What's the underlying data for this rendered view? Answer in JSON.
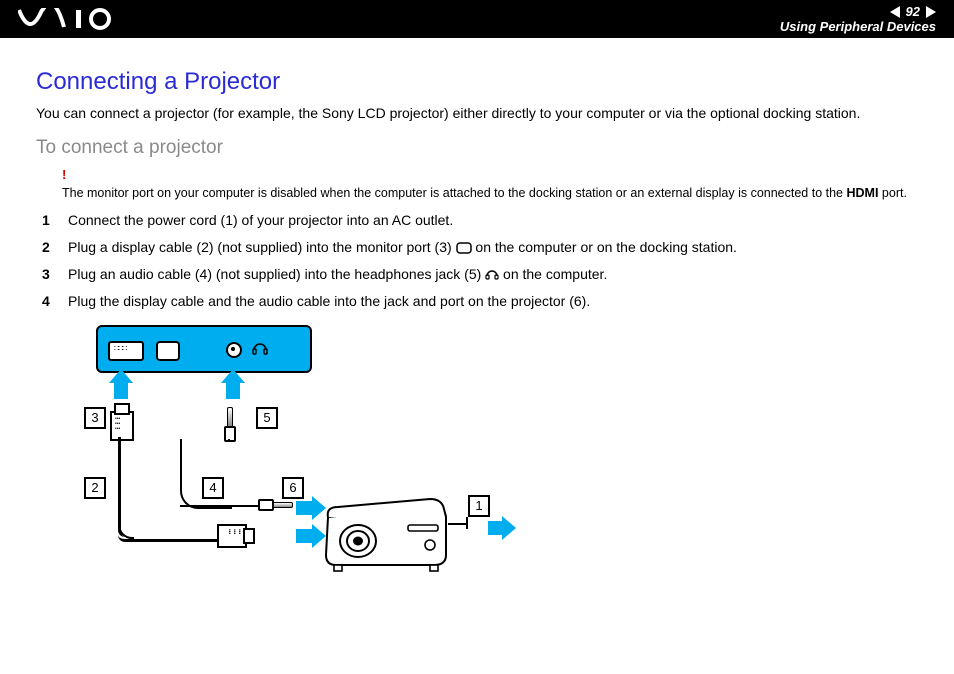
{
  "header": {
    "page_number": "92",
    "section": "Using Peripheral Devices"
  },
  "title": "Connecting a Projector",
  "intro": "You can connect a projector (for example, the Sony LCD projector) either directly to your computer or via the optional docking station.",
  "subtitle": "To connect a projector",
  "note": {
    "mark": "!",
    "text_before_bold": "The monitor port on your computer is disabled when the computer is attached to the docking station or an external display is connected to the ",
    "bold": "HDMI",
    "text_after_bold": " port."
  },
  "steps": [
    {
      "text": "Connect the power cord (1) of your projector into an AC outlet."
    },
    {
      "before": "Plug a display cable (2) (not supplied) into the monitor port (3) ",
      "icon": "monitor-port-icon",
      "after": " on the computer or on the docking station."
    },
    {
      "before": "Plug an audio cable (4) (not supplied) into the headphones jack (5) ",
      "icon": "headphones-icon",
      "after": " on the computer."
    },
    {
      "text": "Plug the display cable and the audio cable into the jack and port on the projector (6)."
    }
  ],
  "diagram": {
    "labels": {
      "n1": "1",
      "n2": "2",
      "n3": "3",
      "n4": "4",
      "n5": "5",
      "n6": "6"
    }
  }
}
